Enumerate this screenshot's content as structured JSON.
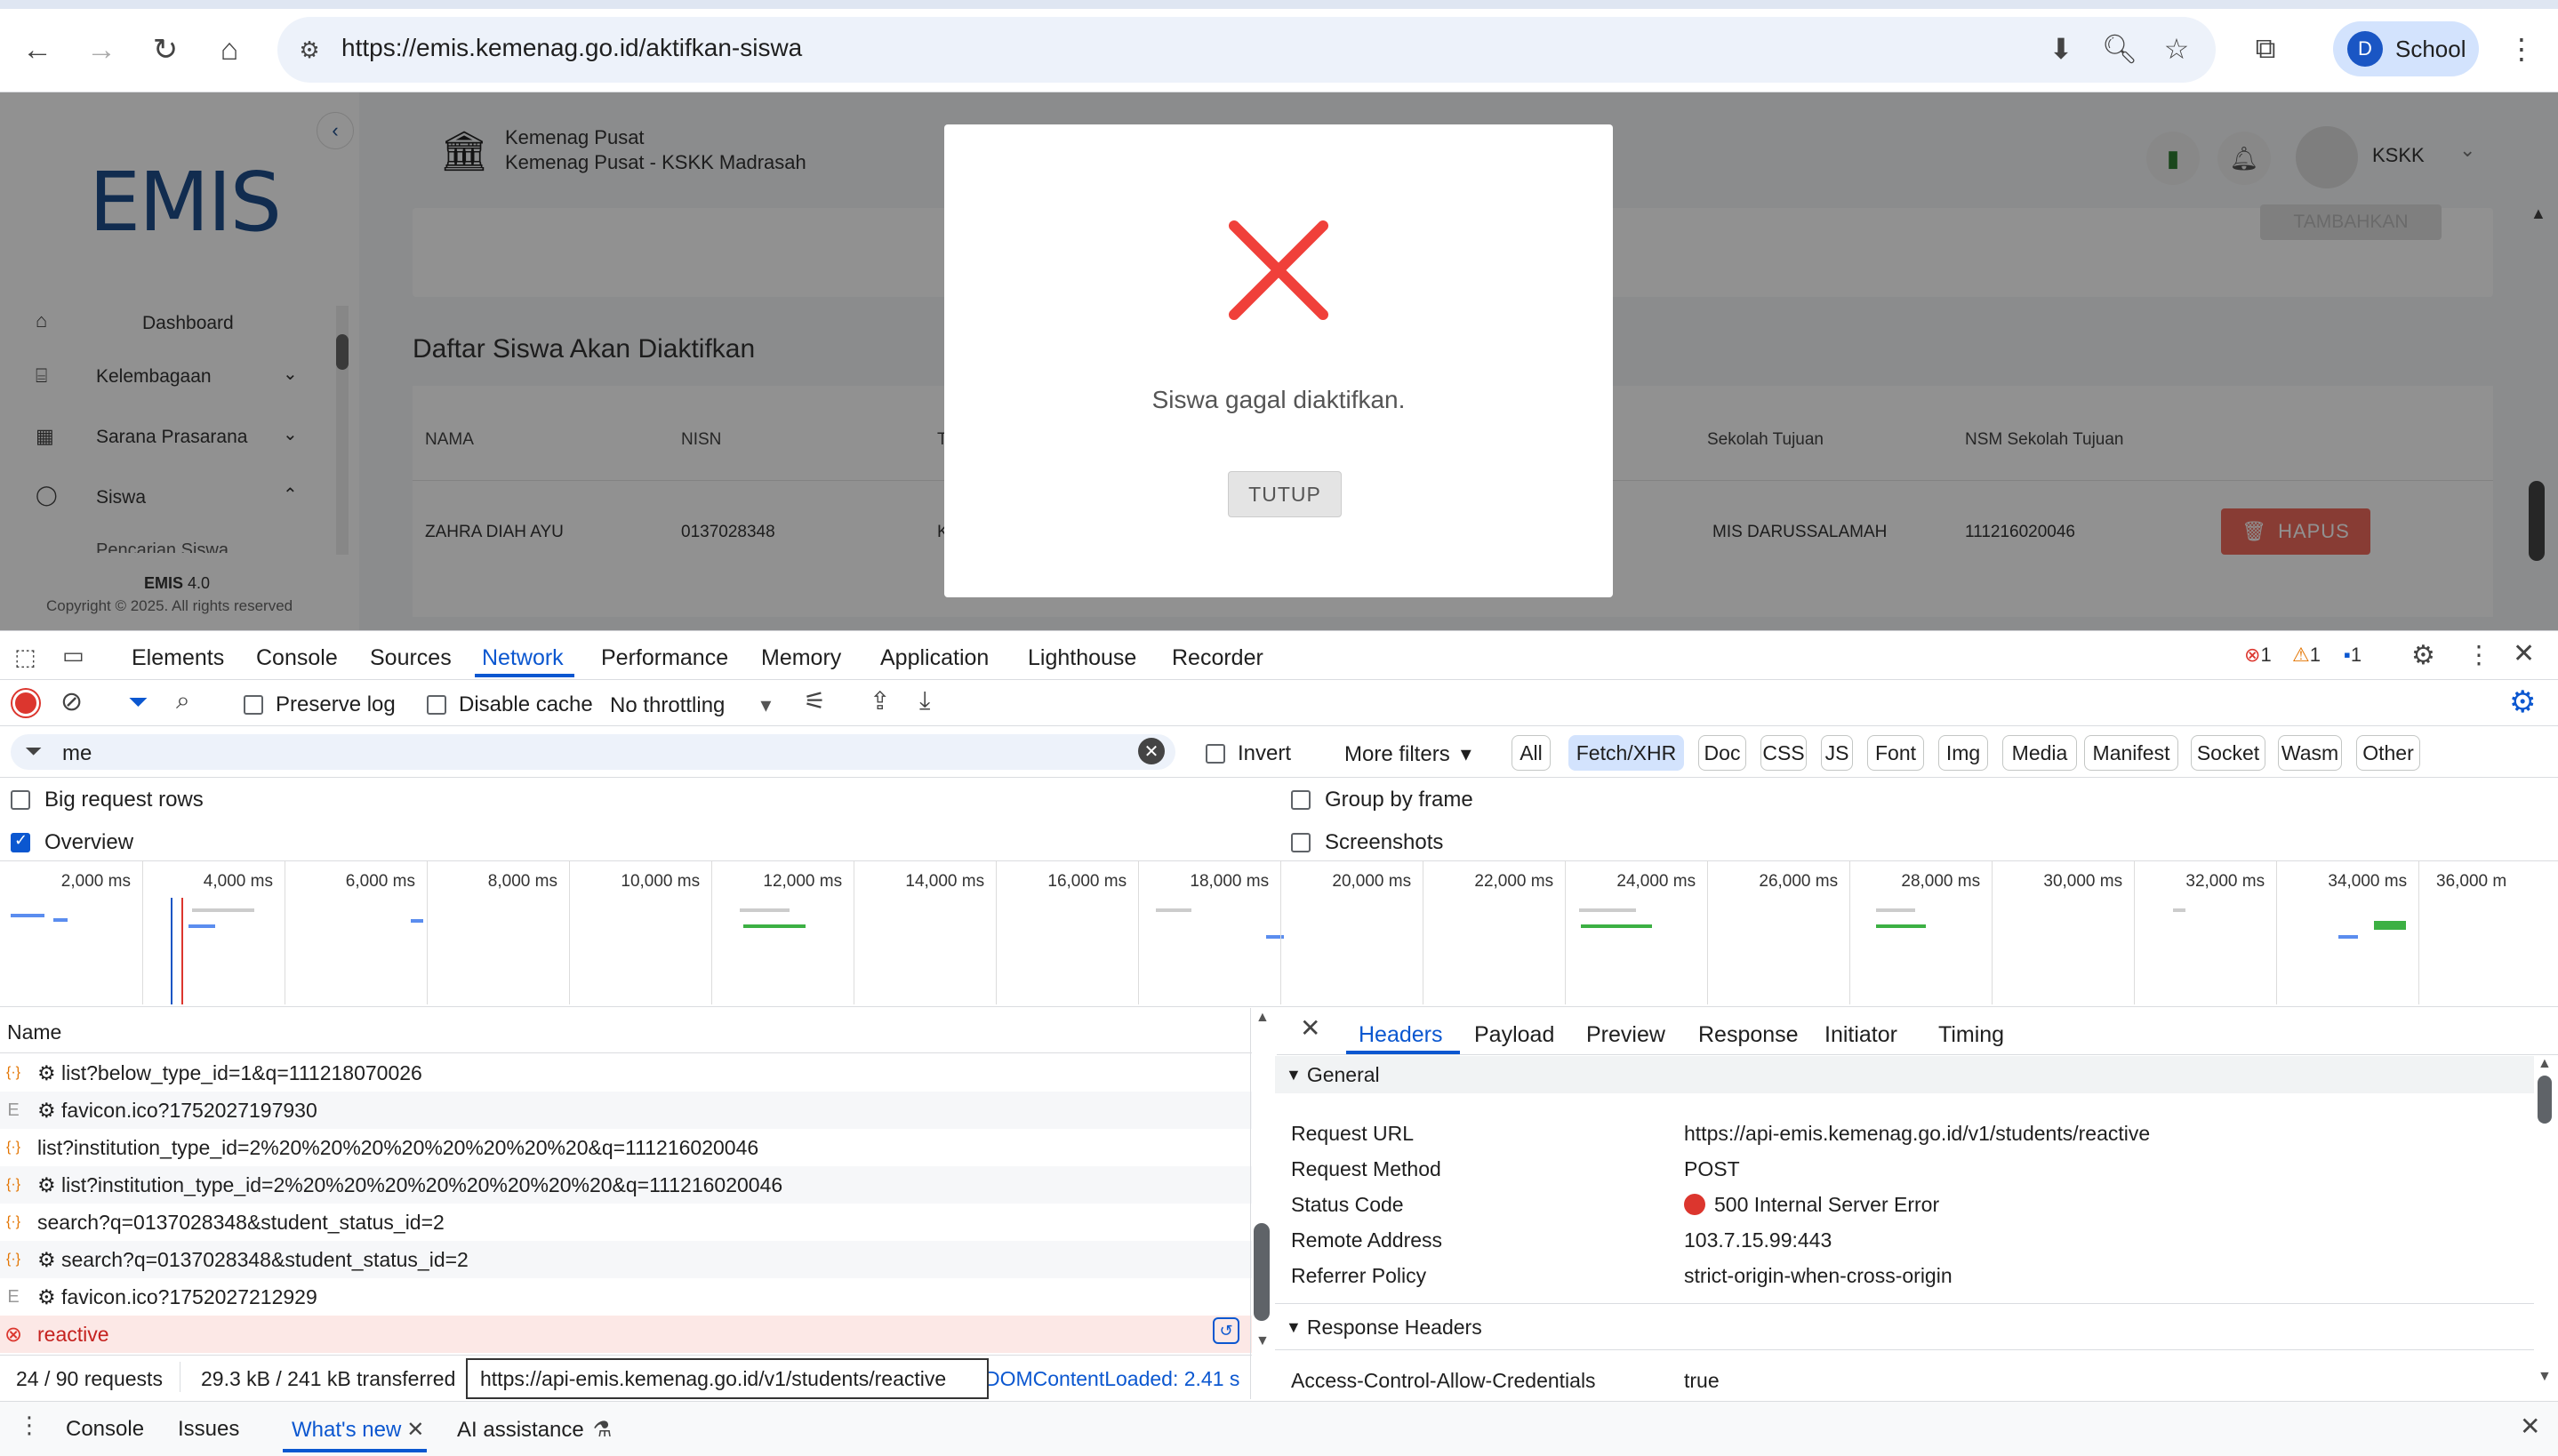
{
  "browser": {
    "url": "https://emis.kemenag.go.id/aktifkan-siswa",
    "profile_initial": "D",
    "profile_name": "School"
  },
  "app": {
    "logo_text": "EMIS",
    "org_line1": "Kemenag Pusat",
    "org_line2": "Kemenag Pusat - KSKK Madrasah",
    "user_name": "KSKK",
    "tambahkan_label": "TAMBAHKAN",
    "sidebar": {
      "items": [
        {
          "label": "Dashboard",
          "icon": "home-icon"
        },
        {
          "label": "Kelembagaan",
          "icon": "institution-icon"
        },
        {
          "label": "Sarana Prasarana",
          "icon": "building-icon"
        },
        {
          "label": "Siswa",
          "icon": "user-icon"
        }
      ],
      "partial_item": "Pencarian Siswa",
      "footer_brand": "EMIS",
      "footer_version": "4.0",
      "footer_copy": "Copyright © 2025. All rights reserved"
    },
    "section_title": "Daftar Siswa Akan Diaktifkan",
    "table": {
      "headers": [
        "NAMA",
        "NISN",
        "T",
        "Sekolah Tujuan",
        "NSM Sekolah Tujuan"
      ],
      "row": {
        "nama": "ZAHRA DIAH AYU",
        "nisn": "0137028348",
        "t": "K",
        "sekolah": "MIS DARUSSALAMAH",
        "nsm": "111216020046"
      },
      "delete_label": "HAPUS"
    }
  },
  "modal": {
    "message": "Siswa gagal diaktifkan.",
    "close_label": "TUTUP",
    "icon_color": "#f0403a"
  },
  "devtools": {
    "tabs": [
      "Elements",
      "Console",
      "Sources",
      "Network",
      "Performance",
      "Memory",
      "Application",
      "Lighthouse",
      "Recorder"
    ],
    "active_tab": "Network",
    "error_count": "1",
    "warning_count": "1",
    "info_count": "1",
    "preserve_log": "Preserve log",
    "disable_cache": "Disable cache",
    "throttling": "No throttling",
    "filter_value": "me",
    "invert": "Invert",
    "more_filters": "More filters",
    "type_filters": [
      "All",
      "Fetch/XHR",
      "Doc",
      "CSS",
      "JS",
      "Font",
      "Img",
      "Media",
      "Manifest",
      "Socket",
      "Wasm",
      "Other"
    ],
    "active_type": "Fetch/XHR",
    "big_rows": "Big request rows",
    "overview": "Overview",
    "group_by_frame": "Group by frame",
    "screenshots": "Screenshots",
    "timeline_ticks": [
      "2,000 ms",
      "4,000 ms",
      "6,000 ms",
      "8,000 ms",
      "10,000 ms",
      "12,000 ms",
      "14,000 ms",
      "16,000 ms",
      "18,000 ms",
      "20,000 ms",
      "22,000 ms",
      "24,000 ms",
      "26,000 ms",
      "28,000 ms",
      "30,000 ms",
      "32,000 ms",
      "34,000 ms",
      "36,000 m"
    ],
    "name_header": "Name",
    "requests": [
      {
        "name": "⚙ list?below_type_id=1&q=111218070026",
        "kind": "xhr"
      },
      {
        "name": "⚙ favicon.ico?1752027197930",
        "kind": "doc"
      },
      {
        "name": "list?institution_type_id=2%20%20%20%20%20%20%20%20&q=111216020046",
        "kind": "xhr"
      },
      {
        "name": "⚙ list?institution_type_id=2%20%20%20%20%20%20%20%20&q=111216020046",
        "kind": "xhr"
      },
      {
        "name": "search?q=0137028348&student_status_id=2",
        "kind": "xhr"
      },
      {
        "name": "⚙ search?q=0137028348&student_status_id=2",
        "kind": "xhr"
      },
      {
        "name": "⚙ favicon.ico?1752027212929",
        "kind": "doc"
      },
      {
        "name": "reactive",
        "kind": "error"
      }
    ],
    "status_requests": "24 / 90 requests",
    "status_transferred": "29.3 kB / 241 kB transferred",
    "status_tooltip": "https://api-emis.kemenag.go.id/v1/students/reactive",
    "status_domloaded": "DOMContentLoaded: 2.41 s",
    "detail_tabs": [
      "Headers",
      "Payload",
      "Preview",
      "Response",
      "Initiator",
      "Timing"
    ],
    "active_detail_tab": "Headers",
    "general_title": "General",
    "general": [
      {
        "key": "Request URL",
        "value": "https://api-emis.kemenag.go.id/v1/students/reactive"
      },
      {
        "key": "Request Method",
        "value": "POST"
      },
      {
        "key": "Status Code",
        "value": "500 Internal Server Error"
      },
      {
        "key": "Remote Address",
        "value": "103.7.15.99:443"
      },
      {
        "key": "Referrer Policy",
        "value": "strict-origin-when-cross-origin"
      }
    ],
    "response_headers_title": "Response Headers",
    "response_headers": [
      {
        "key": "Access-Control-Allow-Credentials",
        "value": "true"
      }
    ],
    "drawer_tabs": [
      "Console",
      "Issues",
      "What's new",
      "AI assistance"
    ],
    "active_drawer_tab": "What's new"
  }
}
